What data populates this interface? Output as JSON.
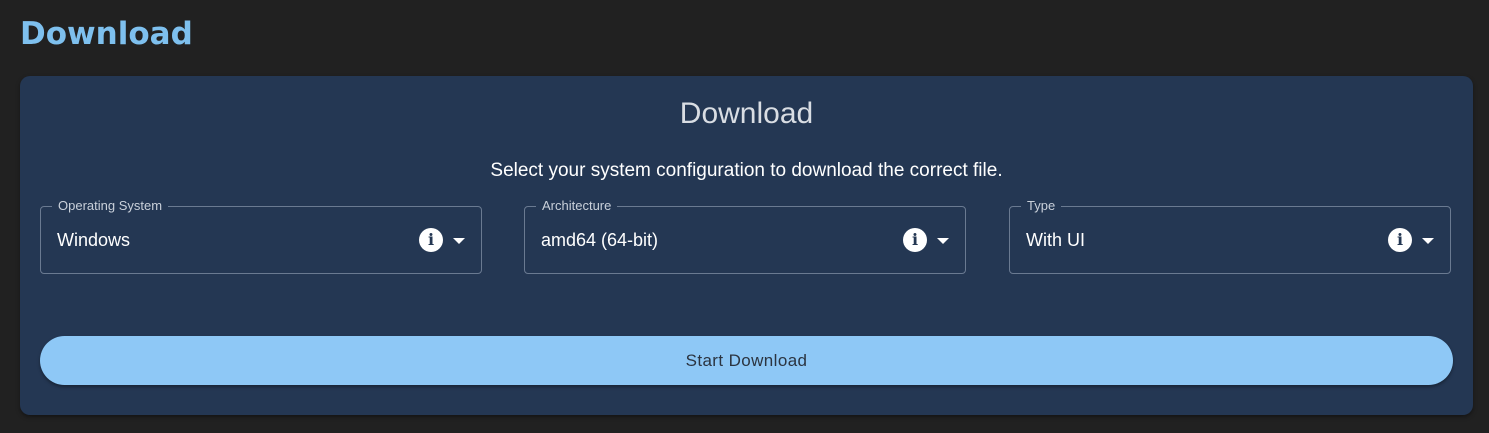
{
  "page": {
    "heading": "Download"
  },
  "card": {
    "title": "Download",
    "subtitle": "Select your system configuration to download the correct file.",
    "fields": [
      {
        "label": "Operating System",
        "value": "Windows",
        "icon": "info-icon"
      },
      {
        "label": "Architecture",
        "value": "amd64 (64-bit)",
        "icon": "info-icon"
      },
      {
        "label": "Type",
        "value": "With UI",
        "icon": "info-icon"
      }
    ],
    "button_label": "Start Download"
  },
  "colors": {
    "background": "#212121",
    "card": "#243753",
    "heading": "#7ec0ee",
    "button": "#8ec8f6"
  }
}
